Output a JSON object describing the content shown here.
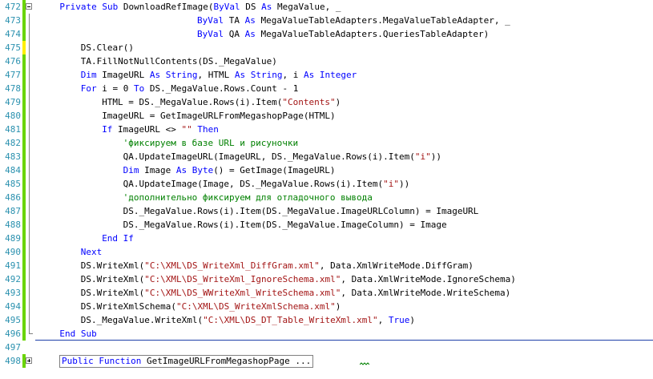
{
  "colors": {
    "keyword": "#0000ff",
    "string": "#a31515",
    "comment": "#008000",
    "line_number": "#2b91af",
    "margin_changed": "#ffef00",
    "margin_saved": "#6ad400",
    "separator": "#1e3fa8"
  },
  "lines": [
    {
      "num": "472",
      "margin": "saved",
      "fold": "minus",
      "indent": 4,
      "tokens": [
        [
          "kw",
          "Private Sub"
        ],
        [
          "t",
          " DownloadRefImage("
        ],
        [
          "kw",
          "ByVal"
        ],
        [
          "t",
          " DS "
        ],
        [
          "kw",
          "As"
        ],
        [
          "t",
          " MegaValue, _"
        ]
      ]
    },
    {
      "num": "473",
      "margin": "saved",
      "indent": 30,
      "tokens": [
        [
          "kw",
          "ByVal"
        ],
        [
          "t",
          " TA "
        ],
        [
          "kw",
          "As"
        ],
        [
          "t",
          " MegaValueTableAdapters.MegaValueTableAdapter, _"
        ]
      ]
    },
    {
      "num": "474",
      "margin": "saved",
      "indent": 30,
      "tokens": [
        [
          "kw",
          "ByVal"
        ],
        [
          "t",
          " QA "
        ],
        [
          "kw",
          "As"
        ],
        [
          "t",
          " MegaValueTableAdapters.QueriesTableAdapter)"
        ]
      ]
    },
    {
      "num": "475",
      "margin": "changed",
      "indent": 8,
      "tokens": [
        [
          "t",
          "DS.Clear()"
        ]
      ]
    },
    {
      "num": "476",
      "margin": "saved",
      "indent": 8,
      "tokens": [
        [
          "t",
          "TA.FillNotNullContents(DS._MegaValue)"
        ]
      ]
    },
    {
      "num": "477",
      "margin": "saved",
      "indent": 8,
      "tokens": [
        [
          "kw",
          "Dim"
        ],
        [
          "t",
          " ImageURL "
        ],
        [
          "kw",
          "As String"
        ],
        [
          "t",
          ", HTML "
        ],
        [
          "kw",
          "As String"
        ],
        [
          "t",
          ", i "
        ],
        [
          "kw",
          "As Integer"
        ]
      ]
    },
    {
      "num": "478",
      "margin": "saved",
      "indent": 8,
      "tokens": [
        [
          "kw",
          "For"
        ],
        [
          "t",
          " i = 0 "
        ],
        [
          "kw",
          "To"
        ],
        [
          "t",
          " DS._MegaValue.Rows.Count - 1"
        ]
      ]
    },
    {
      "num": "479",
      "margin": "saved",
      "indent": 12,
      "tokens": [
        [
          "t",
          "HTML = DS._MegaValue.Rows(i).Item("
        ],
        [
          "str",
          "\"Contents\""
        ],
        [
          "t",
          ")"
        ]
      ]
    },
    {
      "num": "480",
      "margin": "saved",
      "indent": 12,
      "tokens": [
        [
          "t",
          "ImageURL = GetImageURLFromMegashopPage(HTML)"
        ]
      ]
    },
    {
      "num": "481",
      "margin": "saved",
      "indent": 12,
      "tokens": [
        [
          "kw",
          "If"
        ],
        [
          "t",
          " ImageURL <> "
        ],
        [
          "str",
          "\"\""
        ],
        [
          "t",
          " "
        ],
        [
          "kw",
          "Then"
        ]
      ]
    },
    {
      "num": "482",
      "margin": "saved",
      "indent": 16,
      "tokens": [
        [
          "cm",
          "'фиксируем в базе URL и рисуночки"
        ]
      ]
    },
    {
      "num": "483",
      "margin": "saved",
      "indent": 16,
      "tokens": [
        [
          "t",
          "QA.UpdateImageURL(ImageURL, DS._MegaValue.Rows(i).Item("
        ],
        [
          "str",
          "\"i\""
        ],
        [
          "t",
          "))"
        ]
      ]
    },
    {
      "num": "484",
      "margin": "saved",
      "indent": 16,
      "tokens": [
        [
          "kw",
          "Dim"
        ],
        [
          "t",
          " Image "
        ],
        [
          "kw",
          "As Byte"
        ],
        [
          "t",
          "() = GetImage(ImageURL)"
        ]
      ]
    },
    {
      "num": "485",
      "margin": "saved",
      "indent": 16,
      "tokens": [
        [
          "t",
          "QA.UpdateImage(Image, DS._MegaValue.Rows(i).Item("
        ],
        [
          "str",
          "\"i\""
        ],
        [
          "t",
          "))"
        ]
      ]
    },
    {
      "num": "486",
      "margin": "saved",
      "indent": 16,
      "tokens": [
        [
          "cm",
          "'дополнительно фиксируем для отладочного вывода"
        ]
      ]
    },
    {
      "num": "487",
      "margin": "saved",
      "indent": 16,
      "tokens": [
        [
          "t",
          "DS._MegaValue.Rows(i).Item(DS._MegaValue.ImageURLColumn) = ImageURL"
        ]
      ]
    },
    {
      "num": "488",
      "margin": "saved",
      "indent": 16,
      "tokens": [
        [
          "t",
          "DS._MegaValue.Rows(i).Item(DS._MegaValue.ImageColumn) = Image"
        ]
      ]
    },
    {
      "num": "489",
      "margin": "saved",
      "indent": 12,
      "tokens": [
        [
          "kw",
          "End If"
        ]
      ]
    },
    {
      "num": "490",
      "margin": "saved",
      "indent": 8,
      "tokens": [
        [
          "kw",
          "Next"
        ]
      ]
    },
    {
      "num": "491",
      "margin": "saved",
      "indent": 8,
      "tokens": [
        [
          "t",
          "DS.WriteXml("
        ],
        [
          "str",
          "\"C:\\XML\\DS_WriteXml_DiffGram.xml\""
        ],
        [
          "t",
          ", Data.XmlWriteMode.DiffGram)"
        ]
      ]
    },
    {
      "num": "492",
      "margin": "saved",
      "indent": 8,
      "tokens": [
        [
          "t",
          "DS.WriteXml("
        ],
        [
          "str",
          "\"C:\\XML\\DS_WriteXml_IgnoreSchema.xml\""
        ],
        [
          "t",
          ", Data.XmlWriteMode.IgnoreSchema)"
        ]
      ]
    },
    {
      "num": "493",
      "margin": "saved",
      "indent": 8,
      "tokens": [
        [
          "t",
          "DS.WriteXml("
        ],
        [
          "str",
          "\"C:\\XML\\DS_WWriteXml_WriteSchema.xml\""
        ],
        [
          "t",
          ", Data.XmlWriteMode.WriteSchema)"
        ]
      ]
    },
    {
      "num": "494",
      "margin": "saved",
      "indent": 8,
      "tokens": [
        [
          "t",
          "DS.WriteXmlSchema("
        ],
        [
          "str",
          "\"C:\\XML\\DS_WriteXmlSchema.xml\""
        ],
        [
          "t",
          ")"
        ]
      ]
    },
    {
      "num": "495",
      "margin": "saved",
      "indent": 8,
      "tokens": [
        [
          "t",
          "DS._MegaValue.WriteXml("
        ],
        [
          "str",
          "\"C:\\XML\\DS_DT_Table_WriteXml.xml\""
        ],
        [
          "t",
          ", "
        ],
        [
          "kw",
          "True"
        ],
        [
          "t",
          ")"
        ]
      ]
    },
    {
      "num": "496",
      "margin": "saved",
      "indent": 4,
      "tokens": [
        [
          "kw",
          "End Sub"
        ]
      ]
    },
    {
      "num": "497",
      "margin": "none",
      "indent": 0,
      "tokens": []
    },
    {
      "num": "498",
      "margin": "saved",
      "fold": "plus",
      "indent": 0,
      "collapsed": true,
      "tokens": [
        [
          "kw",
          "Public Function"
        ],
        [
          "t",
          " GetImageURLFromMegashopPage ..."
        ]
      ]
    }
  ]
}
